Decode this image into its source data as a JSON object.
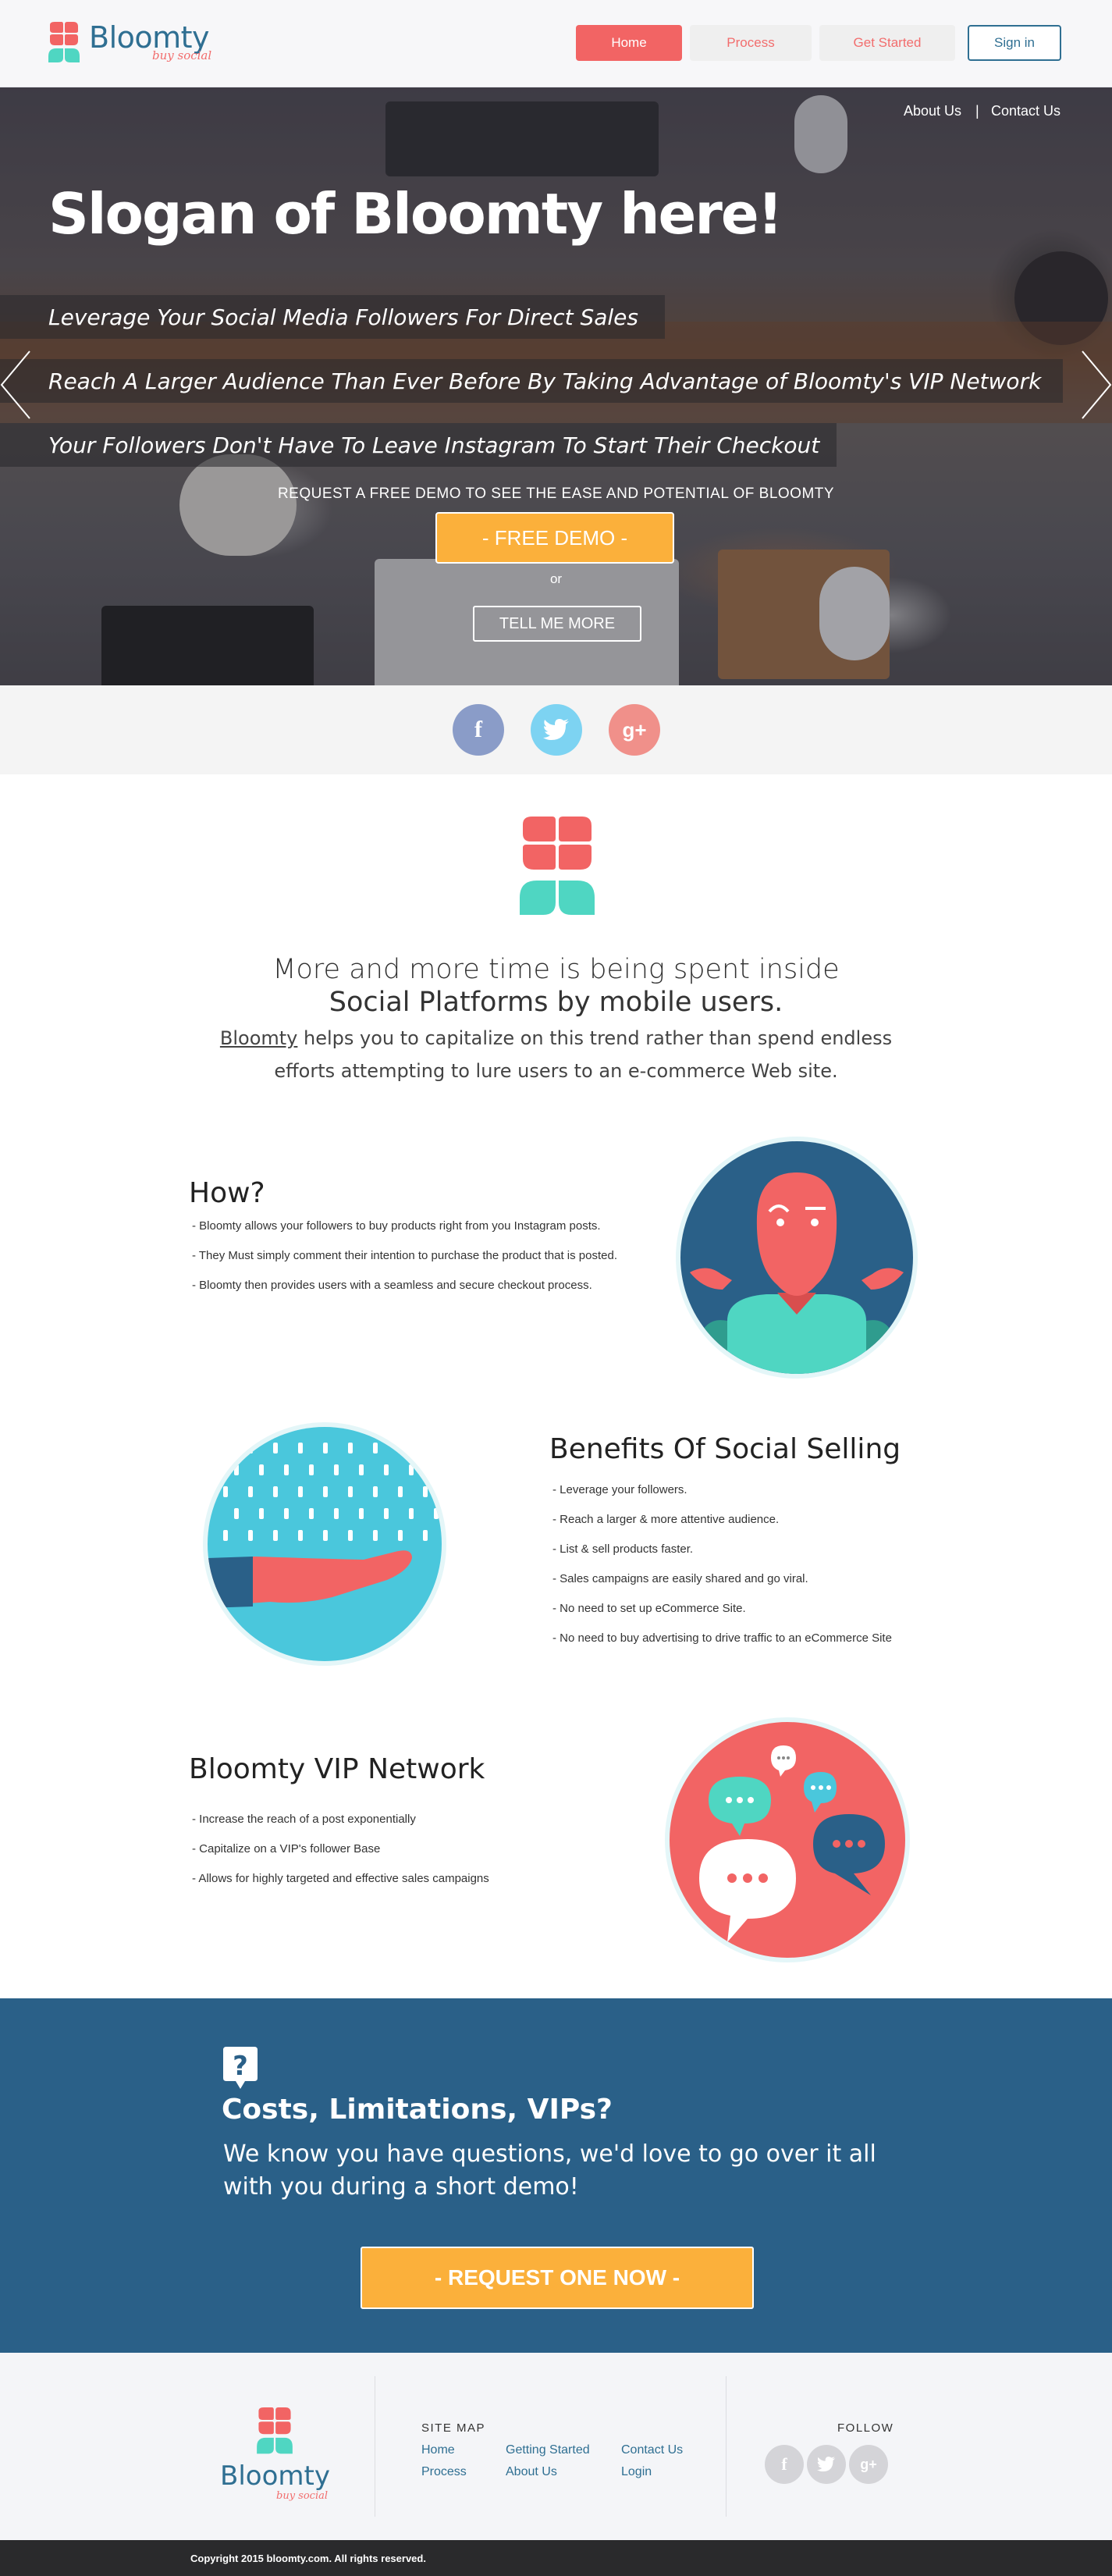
{
  "header": {
    "logo_text": "Bloomty",
    "logo_tagline": "buy social",
    "nav": {
      "home": "Home",
      "process": "Process",
      "get_started": "Get Started",
      "sign_in": "Sign in"
    }
  },
  "hero": {
    "links": {
      "about": "About Us",
      "separator": "|",
      "contact": "Contact Us"
    },
    "slogan": "Slogan of Bloomty here!",
    "lines": [
      "Leverage Your Social Media Followers For Direct Sales",
      "Reach A Larger Audience Than Ever Before By Taking Advantage of Bloomty's VIP Network",
      "Your Followers Don't Have To Leave Instagram To Start Their Checkout"
    ],
    "demo_caption": "REQUEST A FREE DEMO TO SEE THE EASE AND POTENTIAL OF BLOOMTY",
    "demo_button": "- FREE DEMO -",
    "or_text": "or",
    "more_button": "TELL ME MORE"
  },
  "social": {
    "facebook": "f",
    "twitter": "twitter-icon",
    "googleplus": "g+"
  },
  "intro": {
    "heading_line1": "More and more time is being spent inside",
    "heading_line2": "Social Platforms by mobile users.",
    "link_word": "Bloomty",
    "body_line1_rest": " helps you to capitalize on this trend rather than spend endless",
    "body_line2": "efforts attempting to lure users to an e-commerce Web site."
  },
  "how": {
    "title": "How?",
    "items": [
      "- Bloomty allows your followers to buy products right from you Instagram posts.",
      "- They Must simply comment their intention to purchase the product that is posted.",
      "- Bloomty then provides users with a seamless and secure checkout process."
    ]
  },
  "benefits": {
    "title": "Benefits Of Social Selling",
    "items": [
      "- Leverage your followers.",
      "- Reach a larger & more attentive audience.",
      "- List & sell products faster.",
      "- Sales campaigns are easily shared and go viral.",
      "- No need to set up eCommerce Site.",
      "- No need to buy advertising to drive traffic to an eCommerce Site"
    ]
  },
  "vip": {
    "title": "Bloomty VIP Network",
    "items": [
      "- Increase the reach of a post exponentially",
      "- Capitalize on a VIP's follower Base",
      "- Allows for highly targeted and effective sales campaigns"
    ]
  },
  "cta": {
    "title": "Costs, Limitations, VIPs?",
    "body_line1": "We know you have questions, we'd love to go over it all",
    "body_line2": "with you during a short demo!",
    "button": "- REQUEST ONE NOW -"
  },
  "footer": {
    "logo_text": "Bloomty",
    "logo_tagline": "buy social",
    "sitemap_title": "SITE MAP",
    "sitemap_links": {
      "home": "Home",
      "process": "Process",
      "getting_started": "Getting Started",
      "about": "About Us",
      "contact": "Contact Us",
      "login": "Login"
    },
    "follow_title": "FOLLOW",
    "copyright": "Copyright 2015 bloomty.com. All rights reserved."
  },
  "colors": {
    "brand_blue": "#2f6f92",
    "brand_coral": "#f26464",
    "accent_orange": "#fbb03b",
    "teal": "#4fd6c2",
    "cta_bg": "#2a6088"
  }
}
